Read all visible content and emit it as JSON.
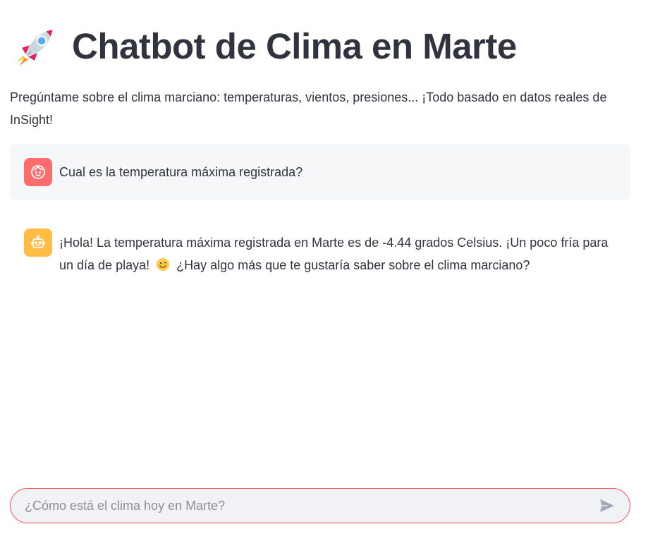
{
  "header": {
    "icon": "rocket-icon",
    "title": "Chatbot de Clima en Marte"
  },
  "intro": {
    "text": "Pregúntame sobre el clima marciano: temperaturas, vientos, presiones... ¡Todo basado en datos reales de InSight!"
  },
  "messages": [
    {
      "role": "user",
      "avatar_icon": "user-face-icon",
      "text": "Cual es la temperatura máxima registrada?"
    },
    {
      "role": "assistant",
      "avatar_icon": "robot-icon",
      "text_before_emoji": "¡Hola! La temperatura máxima registrada en Marte es de -4.44 grados Celsius. ¡Un poco fría para un día de playa!",
      "emoji": "winking-face-icon",
      "text_after_emoji": "¿Hay algo más que te gustaría saber sobre el clima marciano?"
    }
  ],
  "chat_input": {
    "placeholder": "¿Cómo está el clima hoy en Marte?",
    "value": "",
    "send_icon": "send-icon"
  },
  "colors": {
    "user_avatar": "#ff6c6c",
    "bot_avatar": "#ffbd45",
    "input_border": "#ff4b4b",
    "text": "#31333f"
  }
}
